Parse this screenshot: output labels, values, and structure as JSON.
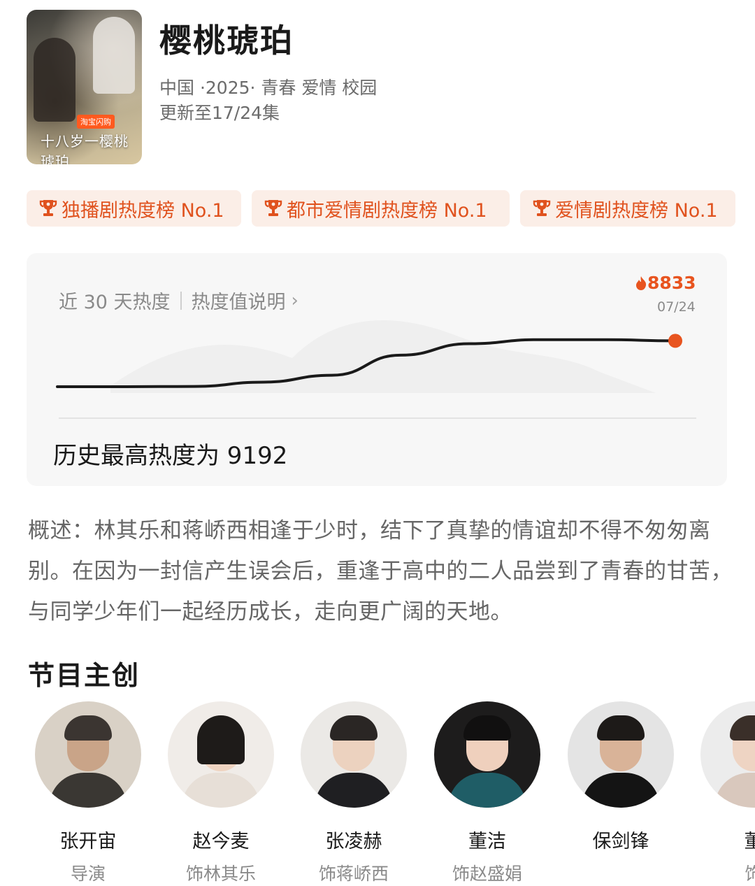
{
  "show": {
    "poster_alt": "樱桃琥珀",
    "poster_tag": "淘宝闪购",
    "poster_script": "十八岁一樱桃琥珀",
    "title": "樱桃琥珀",
    "meta": "中国 ·2025· 青春 爱情 校园",
    "update": "更新至17/24集"
  },
  "badges": [
    {
      "label": "独播剧热度榜 No.1",
      "icon": "trophy-icon"
    },
    {
      "label": "都市爱情剧热度榜 No.1",
      "icon": "trophy-icon"
    },
    {
      "label": "爱情剧热度榜 No.1",
      "icon": "trophy-icon"
    }
  ],
  "heat": {
    "range_label": "近 30 天热度",
    "explain_label": "热度值说明",
    "current_value": "8833",
    "current_date": "07/24",
    "history_text": "历史最高热度为 9192"
  },
  "chart_data": {
    "type": "line",
    "x": [
      "d1",
      "d5",
      "d10",
      "d13",
      "d16",
      "d20",
      "d22",
      "d24",
      "d26",
      "d30"
    ],
    "values": [
      0,
      0,
      0.5,
      8,
      20,
      55,
      75,
      82,
      82,
      80
    ],
    "series_color": "#1a1a1a",
    "endpoint_color": "#e8541f"
  },
  "summary": "概述：林其乐和蒋峤西相逢于少时，结下了真挚的情谊却不得不匆匆离别。在因为一封信产生误会后，重逢于高中的二人品尝到了青春的甘苦，与同学少年们一起经历成长，走向更广阔的天地。",
  "cast_section": {
    "title": "节目主创",
    "members": [
      {
        "name": "张开宙",
        "role": "导演"
      },
      {
        "name": "赵今麦",
        "role": "饰林其乐"
      },
      {
        "name": "张凌赫",
        "role": "饰蒋峤西"
      },
      {
        "name": "董洁",
        "role": "饰赵盛娟"
      },
      {
        "name": "保剑锋",
        "role": ""
      },
      {
        "name": "董",
        "role": "饰"
      }
    ]
  },
  "colors": {
    "accent": "#e8541f",
    "badge_bg": "#fbeee7",
    "card_bg": "#f7f7f7"
  }
}
